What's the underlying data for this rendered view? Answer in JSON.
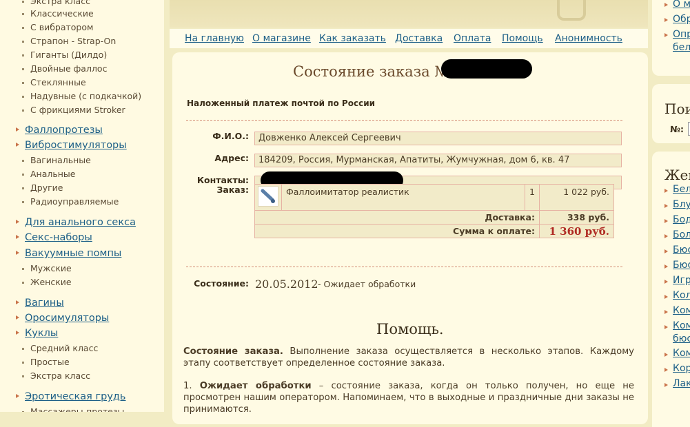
{
  "sidebar": {
    "top_partial": "Экстра класс",
    "dildo_subs": [
      "Классические",
      "С вибратором",
      "Страпон - Strap-On",
      "Гиганты (Дилдо)",
      "Двойные фаллос",
      "Стеклянные",
      "Надувные (с подкачкой)",
      "С фрикциями Stroker"
    ],
    "phalloprostheses": "Фаллопротезы",
    "vibrostimulators": "Вибростимуляторы",
    "vibro_subs": [
      "Вагинальные",
      "Анальные",
      "Другие",
      "Радиоуправляемые"
    ],
    "anal": "Для анального секса",
    "sex_sets": "Секс-наборы",
    "vacuum_pumps": "Вакуумные помпы",
    "pump_subs": [
      "Мужские",
      "Женские"
    ],
    "vaginas": "Вагины",
    "orosimulators": "Оросимуляторы",
    "dolls": "Куклы",
    "doll_subs": [
      "Средний класс",
      "Простые",
      "Экстра класс"
    ],
    "erotic_breast": "Эротическая грудь",
    "bottom_partial": "Массажеры-протезы"
  },
  "nav": [
    "На главную",
    "О магазине",
    "Как заказать",
    "Доставка",
    "Оплата",
    "Помощь",
    "Анонимность"
  ],
  "order": {
    "title": "Состояние заказа №",
    "payment_method": "Наложенный платеж почтой по России",
    "labels": {
      "fio": "Ф.И.О.:",
      "address": "Адрес:",
      "contacts": "Контакты:",
      "order": "Заказ:",
      "status": "Состояние:"
    },
    "fio": "Довженко Алексей Сергеевич",
    "address": "184209, Россия, Мурманская, Апатиты, Жумчужная, дом 6, кв. 47",
    "item": {
      "name": "Фаллоимитатор реалистик",
      "qty": "1",
      "price": "1 022 руб."
    },
    "delivery_label": "Доставка:",
    "delivery_price": "338 руб.",
    "total_label": "Сумма к оплате:",
    "total": "1 360 руб.",
    "status_date": "20.05.2012",
    "status_text": "- Ожидает обработки"
  },
  "help": {
    "title": "Помощь.",
    "p1_bold": "Состояние заказа.",
    "p1_text": " Выполнение заказа осуществляется в несколько этапов. Каждому этапу соответствует определенное состояние заказа.",
    "p2_num": "1. ",
    "p2_bold": "Ожидает обработки",
    "p2_text": " – состояние заказа, когда он только получен, но еще не просмотрен нашим оператором. Напоминаем, что в выходные и праздничные дни заказы не принимаются."
  },
  "right": {
    "box1": [
      "О м",
      "Обр",
      "Опр",
      "бел"
    ],
    "box2_head": "Пои",
    "box2_label": "№:",
    "box3_head": "Жен",
    "box3_links": [
      "Бел",
      "Блу",
      "Бод",
      "Бол",
      "Бюс",
      "Бюс",
      "Игр",
      "Кол",
      "Ком",
      "Ком",
      "бюс",
      "Ком",
      "Кор",
      "Лак"
    ]
  }
}
